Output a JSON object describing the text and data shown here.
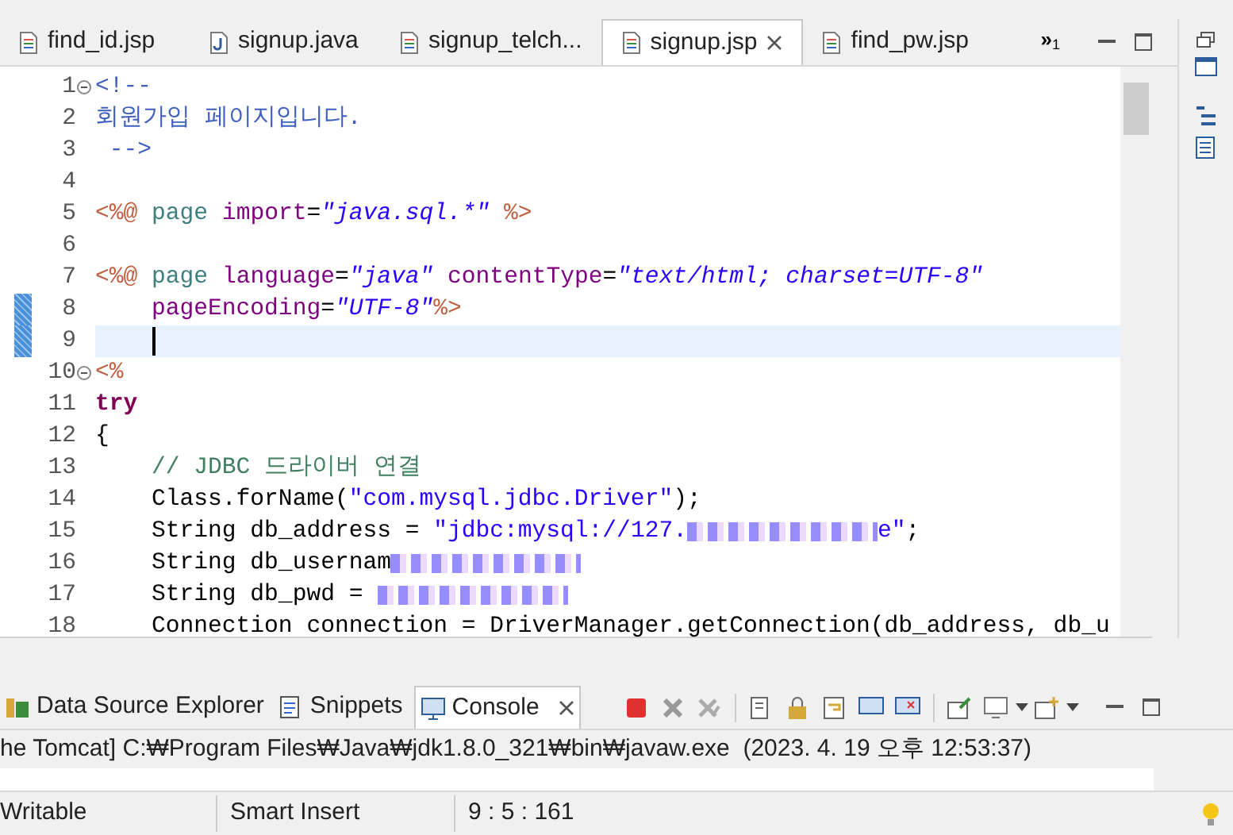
{
  "editor_tabs": [
    {
      "label": "find_id.jsp",
      "kind": "jsp",
      "selected": false
    },
    {
      "label": "signup.java",
      "kind": "java",
      "selected": false
    },
    {
      "label": "signup_telch...",
      "kind": "jsp",
      "selected": false
    },
    {
      "label": "signup.jsp",
      "kind": "jsp",
      "selected": true
    },
    {
      "label": "find_pw.jsp",
      "kind": "jsp",
      "selected": false
    }
  ],
  "overflow": {
    "symbol": "»",
    "count": "1"
  },
  "code_lines": [
    {
      "number": "1",
      "foldable": true,
      "changed": false,
      "current": false,
      "tokens": [
        {
          "kind": "comment",
          "text": "<!--"
        }
      ]
    },
    {
      "number": "2",
      "foldable": false,
      "changed": false,
      "current": false,
      "tokens": [
        {
          "kind": "comment",
          "text": "회원가입 페이지입니다."
        }
      ]
    },
    {
      "number": "3",
      "foldable": false,
      "changed": false,
      "current": false,
      "tokens": [
        {
          "kind": "comment",
          "text": " -->"
        }
      ]
    },
    {
      "number": "4",
      "foldable": false,
      "changed": false,
      "current": false
    },
    {
      "number": "5",
      "foldable": false,
      "changed": false,
      "current": false,
      "tokens": [
        {
          "kind": "tag",
          "text": "<%@ "
        },
        {
          "kind": "directive",
          "text": "page "
        },
        {
          "kind": "attr",
          "text": "import"
        },
        {
          "kind": "plain",
          "text": "="
        },
        {
          "kind": "value",
          "text": "\"java.sql.*\" "
        },
        {
          "kind": "tag",
          "text": "%>"
        }
      ]
    },
    {
      "number": "6",
      "foldable": false,
      "changed": false,
      "current": false
    },
    {
      "number": "7",
      "foldable": false,
      "changed": false,
      "current": false,
      "tokens": [
        {
          "kind": "tag",
          "text": "<%@ "
        },
        {
          "kind": "directive",
          "text": "page "
        },
        {
          "kind": "attr",
          "text": "language"
        },
        {
          "kind": "plain",
          "text": "="
        },
        {
          "kind": "value",
          "text": "\"java\" "
        },
        {
          "kind": "attr",
          "text": "contentType"
        },
        {
          "kind": "plain",
          "text": "="
        },
        {
          "kind": "value",
          "text": "\"text/html; charset=UTF-8\""
        }
      ]
    },
    {
      "number": "8",
      "foldable": false,
      "changed": true,
      "current": false,
      "tokens": [
        {
          "kind": "attr",
          "text": "    pageEncoding"
        },
        {
          "kind": "plain",
          "text": "="
        },
        {
          "kind": "value",
          "text": "\"UTF-8\""
        },
        {
          "kind": "tag",
          "text": "%>"
        }
      ]
    },
    {
      "number": "9",
      "foldable": false,
      "changed": true,
      "current": true
    },
    {
      "number": "10",
      "foldable": true,
      "changed": false,
      "current": false,
      "tokens": [
        {
          "kind": "tag",
          "text": "<%"
        }
      ]
    },
    {
      "number": "11",
      "foldable": false,
      "changed": false,
      "current": false,
      "tokens": [
        {
          "kind": "keyword",
          "text": "try"
        }
      ]
    },
    {
      "number": "12",
      "foldable": false,
      "changed": false,
      "current": false,
      "tokens": [
        {
          "kind": "plain",
          "text": "{"
        }
      ]
    },
    {
      "number": "13",
      "foldable": false,
      "changed": false,
      "current": false,
      "tokens": [
        {
          "kind": "jcomment",
          "text": "    // JDBC 드라이버 연결"
        }
      ]
    },
    {
      "number": "14",
      "foldable": false,
      "changed": false,
      "current": false,
      "tokens": [
        {
          "kind": "plain",
          "text": "    Class.forName("
        },
        {
          "kind": "jstring",
          "text": "\"com.mysql.jdbc.Driver\""
        },
        {
          "kind": "plain",
          "text": ");"
        }
      ]
    },
    {
      "number": "15",
      "foldable": false,
      "changed": false,
      "current": false,
      "tokens": [
        {
          "kind": "plain",
          "text": "    String db_address = "
        },
        {
          "kind": "jstring",
          "text": "\"jdbc:mysql://127."
        },
        {
          "kind": "redacted"
        },
        {
          "kind": "jstring",
          "text": "e\""
        },
        {
          "kind": "plain",
          "text": ";"
        }
      ]
    },
    {
      "number": "16",
      "foldable": false,
      "changed": false,
      "current": false,
      "tokens": [
        {
          "kind": "plain",
          "text": "    String db_usernam"
        },
        {
          "kind": "redacted"
        }
      ]
    },
    {
      "number": "17",
      "foldable": false,
      "changed": false,
      "current": false,
      "tokens": [
        {
          "kind": "plain",
          "text": "    String db_pwd = "
        },
        {
          "kind": "redacted"
        }
      ]
    },
    {
      "number": "18",
      "foldable": false,
      "changed": false,
      "current": false,
      "tokens": [
        {
          "kind": "plain",
          "text": "    Connection connection = DriverManager.getConnection(db_address, db_u"
        }
      ]
    }
  ],
  "bottom_tabs": [
    {
      "label": "Data Source Explorer",
      "kind": "datasource",
      "selected": false
    },
    {
      "label": "Snippets",
      "kind": "snippets",
      "selected": false
    },
    {
      "label": "Console",
      "kind": "console",
      "selected": true
    }
  ],
  "console": {
    "header": "he Tomcat] C:₩Program Files₩Java₩jdk1.8.0_321₩bin₩javaw.exe  (2023. 4. 19 오후 12:53:37)"
  },
  "status_bar": {
    "mode": "Writable",
    "insert": "Smart Insert",
    "position": "9 : 5 : 161"
  }
}
